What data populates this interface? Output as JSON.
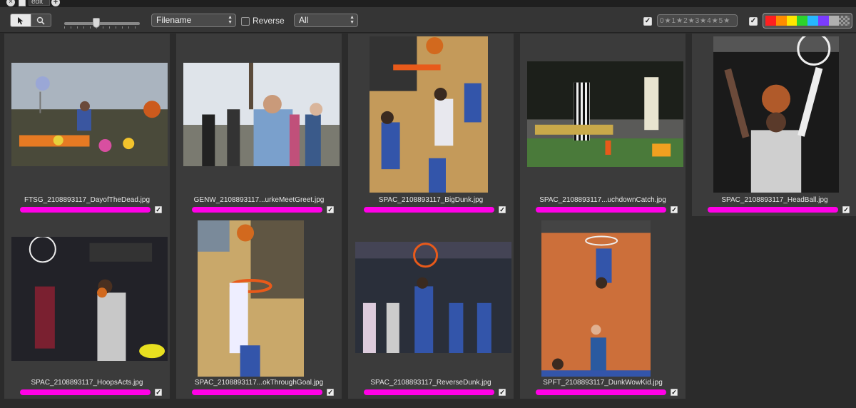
{
  "tab": {
    "label": "edit"
  },
  "toolbar": {
    "sort_field": "Filename",
    "reverse_label": "Reverse",
    "filter": "All",
    "rating_labels": [
      "0",
      "1",
      "2",
      "3",
      "4",
      "5"
    ],
    "colors": [
      "#ff2020",
      "#ff8c00",
      "#ffe600",
      "#2dd32d",
      "#27b7ff",
      "#7b3cff",
      "#b0b0b0"
    ]
  },
  "photos": [
    {
      "filename": "FTSG_2108893117_DayofTheDead.jpg",
      "subject": "day-of-the-dead-altar",
      "checked": "✓"
    },
    {
      "filename": "GENW_2108893117...urkeMeetGreet.jpg",
      "subject": "candidate-meet-greet",
      "checked": "✓"
    },
    {
      "filename": "SPAC_2108893117_BigDunk.jpg",
      "subject": "basketball-big-dunk",
      "checked": "✓"
    },
    {
      "filename": "SPAC_2108893117...uchdownCatch.jpg",
      "subject": "football-touchdown-catch",
      "checked": "✓"
    },
    {
      "filename": "SPAC_2108893117_HeadBall.jpg",
      "subject": "basketball-head-ball",
      "checked": "✓"
    },
    {
      "filename": "SPAC_2108893117_HoopsActs.jpg",
      "subject": "basketball-hoops-acts",
      "checked": "✓"
    },
    {
      "filename": "SPAC_2108893117...okThroughGoal.jpg",
      "subject": "basketball-look-through-goal",
      "checked": "✓"
    },
    {
      "filename": "SPAC_2108893117_ReverseDunk.jpg",
      "subject": "basketball-reverse-dunk",
      "checked": "✓"
    },
    {
      "filename": "SPFT_2108893117_DunkWowKid.jpg",
      "subject": "basketball-dunk-wow-kid",
      "checked": "✓"
    }
  ]
}
